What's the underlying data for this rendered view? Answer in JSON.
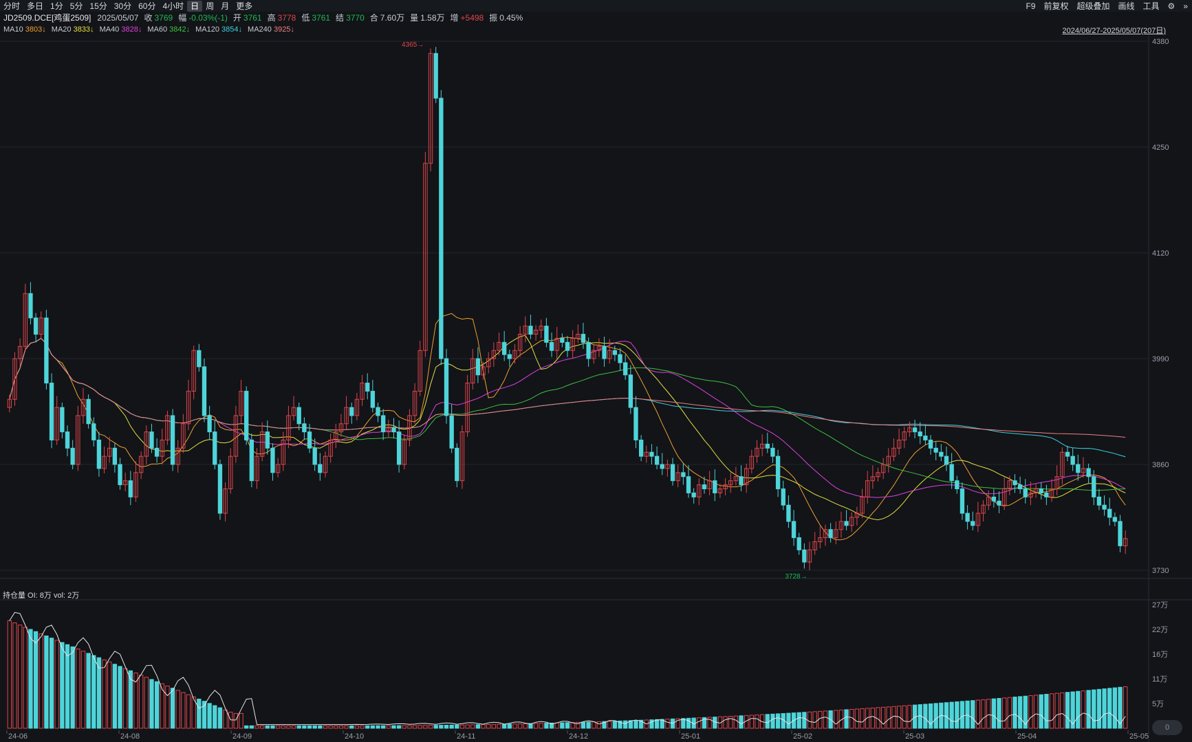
{
  "toolbar": {
    "periods": [
      "分时",
      "多日",
      "1分",
      "5分",
      "15分",
      "30分",
      "60分",
      "4小时",
      "日",
      "周",
      "月",
      "更多"
    ],
    "active_period": "日",
    "right_items": [
      "F9",
      "前复权",
      "超级叠加",
      "画线",
      "工具"
    ]
  },
  "quote": {
    "symbol": "JD2509.DCE[鸡蛋2509]",
    "date": "2025/05/07",
    "close_label": "收",
    "close": "3769",
    "change_label": "幅",
    "change": "-0.03%(-1)",
    "open_label": "开",
    "open": "3761",
    "high_label": "高",
    "high": "3778",
    "low_label": "低",
    "low": "3761",
    "settle_label": "结",
    "settle": "3770",
    "amount_label": "合",
    "amount": "7.60万",
    "volume_label": "量",
    "volume": "1.58万",
    "oi_change_label": "增",
    "oi_change": "+5498",
    "amplitude_label": "振",
    "amplitude": "0.45%"
  },
  "ma_legend": [
    {
      "label": "MA10",
      "value": "3803↓",
      "color": "#f0a030"
    },
    {
      "label": "MA20",
      "value": "3833↓",
      "color": "#e8e040"
    },
    {
      "label": "MA40",
      "value": "3828↓",
      "color": "#e040e0"
    },
    {
      "label": "MA60",
      "value": "3842↓",
      "color": "#40c040"
    },
    {
      "label": "MA120",
      "value": "3854↓",
      "color": "#40d0e0"
    },
    {
      "label": "MA240",
      "value": "3925↓",
      "color": "#f08080"
    }
  ],
  "date_range": "2024/06/27-2025/05/07(207日)",
  "oi_panel": {
    "title": "持仓量 OI: 8万 vol: 2万"
  },
  "watermark": "0",
  "colors": {
    "up": "#e0464b",
    "down": "#4ed4d9",
    "bg": "#121418",
    "grid": "#22262c"
  },
  "chart_data": {
    "type": "candlestick",
    "price_axis_ticks": [
      "4380",
      "4250",
      "4120",
      "3990",
      "3860",
      "3730"
    ],
    "price_range": [
      3730,
      4380
    ],
    "volume_axis_ticks": [
      "27万",
      "22万",
      "16万",
      "11万",
      "5万",
      "0"
    ],
    "x_tick_labels": [
      "24-06",
      "24-08",
      "24-09",
      "24-10",
      "24-11",
      "24-12",
      "25-01",
      "25-02",
      "25-03",
      "25-04",
      "25-05"
    ],
    "annotations": {
      "max_label": "4365",
      "min_label": "3728"
    },
    "closes": [
      3940,
      3990,
      4005,
      4070,
      4040,
      4020,
      4040,
      3960,
      3890,
      3930,
      3900,
      3880,
      3860,
      3920,
      3940,
      3910,
      3890,
      3855,
      3870,
      3880,
      3860,
      3835,
      3840,
      3820,
      3850,
      3870,
      3900,
      3880,
      3870,
      3890,
      3920,
      3860,
      3880,
      3910,
      3950,
      4000,
      3980,
      3920,
      3900,
      3860,
      3800,
      3830,
      3870,
      3920,
      3950,
      3890,
      3840,
      3870,
      3900,
      3880,
      3850,
      3860,
      3890,
      3920,
      3930,
      3910,
      3900,
      3880,
      3860,
      3850,
      3870,
      3890,
      3900,
      3910,
      3930,
      3920,
      3940,
      3960,
      3950,
      3930,
      3920,
      3900,
      3905,
      3900,
      3860,
      3890,
      3920,
      3950,
      4000,
      4230,
      4365,
      4310,
      3990,
      3920,
      3880,
      3840,
      3900,
      3960,
      3990,
      3970,
      3980,
      3990,
      4000,
      4010,
      3995,
      3990,
      4000,
      4020,
      4030,
      4020,
      4025,
      4030,
      4010,
      4000,
      4015,
      4010,
      4000,
      4015,
      4020,
      4010,
      3990,
      4000,
      4005,
      3990,
      4000,
      3995,
      3985,
      3970,
      3930,
      3890,
      3870,
      3875,
      3870,
      3860,
      3855,
      3860,
      3840,
      3850,
      3845,
      3825,
      3820,
      3835,
      3830,
      3840,
      3825,
      3830,
      3835,
      3840,
      3845,
      3835,
      3855,
      3870,
      3880,
      3885,
      3880,
      3870,
      3830,
      3810,
      3790,
      3770,
      3755,
      3740,
      3755,
      3765,
      3770,
      3780,
      3770,
      3780,
      3790,
      3785,
      3795,
      3800,
      3820,
      3840,
      3845,
      3850,
      3860,
      3870,
      3880,
      3890,
      3900,
      3905,
      3900,
      3895,
      3890,
      3880,
      3875,
      3870,
      3860,
      3840,
      3830,
      3800,
      3790,
      3785,
      3800,
      3810,
      3820,
      3815,
      3810,
      3830,
      3840,
      3835,
      3830,
      3820,
      3825,
      3830,
      3825,
      3820,
      3830,
      3845,
      3875,
      3870,
      3860,
      3850,
      3855,
      3845,
      3820,
      3810,
      3805,
      3795,
      3790,
      3760,
      3769
    ]
  }
}
